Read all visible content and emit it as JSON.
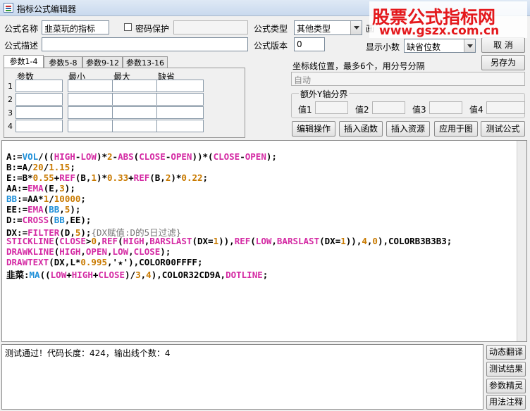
{
  "window": {
    "title": "指标公式编辑器"
  },
  "form": {
    "name_label": "公式名称",
    "name_value": "韭菜玩的指标",
    "password_label": "密码保护",
    "type_label": "公式类型",
    "type_value": "其他类型",
    "desc_label": "公式描述",
    "desc_value": "",
    "version_label": "公式版本",
    "version_value": "0",
    "chart_label_partial": "画",
    "decimals_label": "显示小数",
    "decimals_value": "缺省位数"
  },
  "buttons": {
    "cancel": "取 消",
    "save_as": "另存为",
    "edit_ops": "编辑操作",
    "insert_func": "插入函数",
    "insert_res": "插入资源",
    "apply_chart": "应用于图",
    "test": "测试公式",
    "dynamic_translate": "动态翻译",
    "test_result": "测试结果",
    "param_wizard": "参数精灵",
    "usage_notes": "用法注释"
  },
  "params": {
    "tabs": [
      "参数1-4",
      "参数5-8",
      "参数9-12",
      "参数13-16"
    ],
    "headers": [
      "参数",
      "最小",
      "最大",
      "缺省"
    ],
    "rows": [
      "1",
      "2",
      "3",
      "4"
    ]
  },
  "axis": {
    "label": "坐标线位置，最多6个，用分号分隔",
    "value": "自动",
    "extra_y_label": "额外Y轴分界",
    "v1": "值1",
    "v2": "值2",
    "v3": "值3",
    "v4": "值4"
  },
  "code_lines": [
    "A:=VOL/((HIGH-LOW)*2-ABS(CLOSE-OPEN))*(CLOSE-OPEN);",
    "B:=A/20/1.15;",
    "E:=B*0.55+REF(B,1)*0.33+REF(B,2)*0.22;",
    "AA:=EMA(E,3);",
    "BB:=AA*1/10000;",
    "EE:=EMA(BB,5);",
    "D:=CROSS(BB,EE);",
    "DX:=FILTER(D,5);{DX赋值:D的5日过滤}",
    "STICKLINE(CLOSE>0,REF(HIGH,BARSLAST(DX=1)),REF(LOW,BARSLAST(DX=1)),4,0),COLORB3B3B3;",
    "DRAWKLINE(HIGH,OPEN,LOW,CLOSE);",
    "DRAWTEXT(DX,L*0.995,'★'),COLOR00FFFF;",
    "韭菜:MA((LOW+HIGH+CLOSE)/3,4),COLOR32CD9A,DOTLINE;"
  ],
  "status": {
    "message": "测试通过！代码长度：424，输出线个数：4"
  },
  "watermark": {
    "line1": "股票公式指标网",
    "line2": "www.gszx.com.cn"
  },
  "colors": {
    "keyword": "#d42aa3",
    "number": "#c97a00",
    "function": "#1e8fd8",
    "watermark": "#e4181c"
  }
}
